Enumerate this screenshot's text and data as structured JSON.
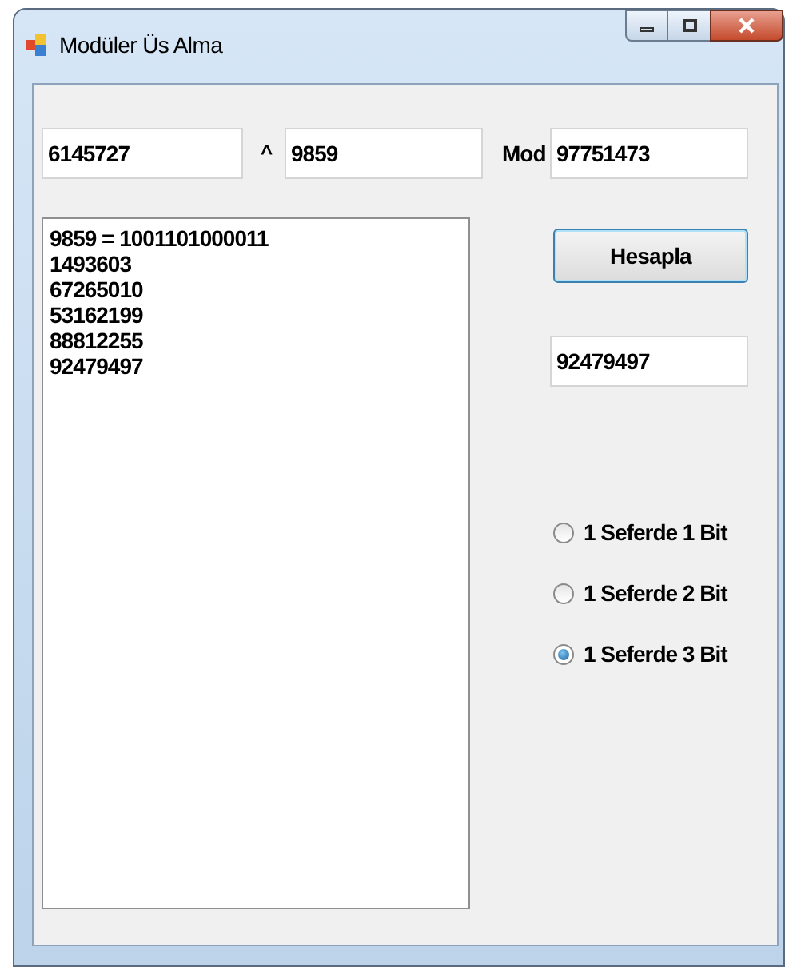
{
  "window": {
    "title": "Modüler Üs Alma"
  },
  "inputs": {
    "base": "6145727",
    "power_sign": "^",
    "exponent": "9859",
    "mod_label": "Mod",
    "modulus": "97751473"
  },
  "output_list": [
    "9859 = 1001101000011",
    "1493603",
    "67265010",
    "53162199",
    "88812255",
    "92479497"
  ],
  "calculate_button": "Hesapla",
  "result": "92479497",
  "modes": [
    {
      "label": "1 Seferde 1 Bit",
      "selected": false
    },
    {
      "label": "1 Seferde 2 Bit",
      "selected": false
    },
    {
      "label": "1 Seferde 3 Bit",
      "selected": true
    }
  ]
}
